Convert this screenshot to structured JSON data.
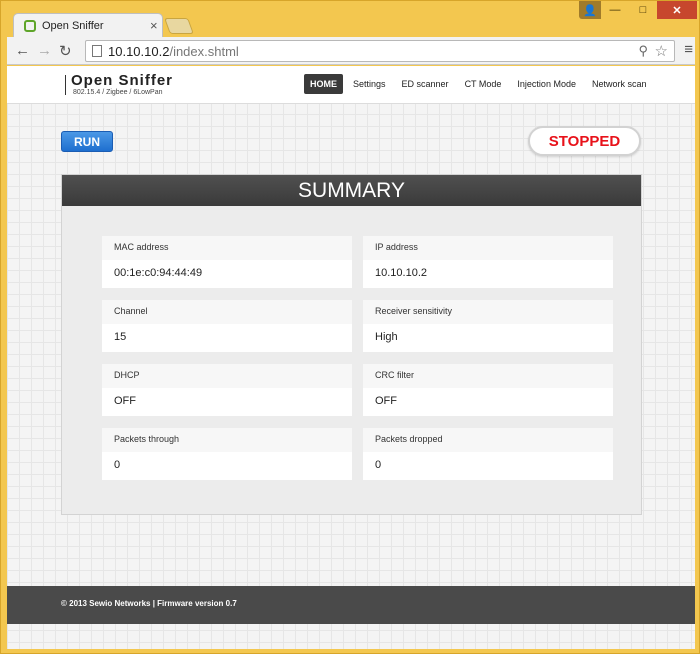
{
  "browser": {
    "tab_title": "Open Sniffer",
    "tab_close": "×",
    "url_host": "10.10.10.2",
    "url_path": "/index.shtml"
  },
  "window_controls": {
    "user": "👤",
    "minimize": "—",
    "maximize": "□",
    "close": "✕"
  },
  "header": {
    "logo_title": "Open Sniffer",
    "logo_subtitle": "802.15.4 / Zigbee / 6LowPan",
    "nav": [
      "HOME",
      "Settings",
      "ED scanner",
      "CT Mode",
      "Injection Mode",
      "Network scan"
    ],
    "active_nav": "HOME"
  },
  "controls": {
    "run_label": "RUN",
    "status": "STOPPED",
    "status_color": "#e8121a"
  },
  "summary": {
    "title": "SUMMARY",
    "fields": [
      {
        "label": "MAC address",
        "value": "00:1e:c0:94:44:49"
      },
      {
        "label": "IP address",
        "value": "10.10.10.2"
      },
      {
        "label": "Channel",
        "value": "15"
      },
      {
        "label": "Receiver sensitivity",
        "value": "High"
      },
      {
        "label": "DHCP",
        "value": "OFF"
      },
      {
        "label": "CRC filter",
        "value": "OFF"
      },
      {
        "label": "Packets through",
        "value": "0"
      },
      {
        "label": "Packets dropped",
        "value": "0"
      }
    ]
  },
  "footer": {
    "text": "© 2013 Sewio Networks | Firmware version 0.7"
  }
}
